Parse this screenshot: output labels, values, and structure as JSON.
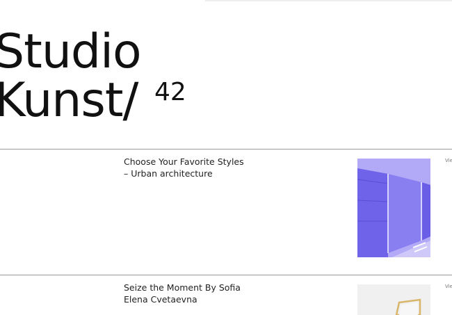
{
  "brand": {
    "line1": "Studio",
    "line2": "Kunst/",
    "number": "42"
  },
  "items": [
    {
      "title_line1": "Choose Your Favorite Styles",
      "title_line2": "– Urban architecture",
      "image": "urban-architecture-image",
      "link": "Vie"
    },
    {
      "title_line1": "Seize the Moment By Sofia",
      "title_line2": "Elena Cvetaevna",
      "image": "frame-image",
      "link": "Vie"
    }
  ],
  "colors": {
    "background": "#ffffff",
    "text": "#111111",
    "rule": "#9a9a9a",
    "accent_purple": "#7b6ef0",
    "image_bg_light": "#f0f0f0"
  }
}
